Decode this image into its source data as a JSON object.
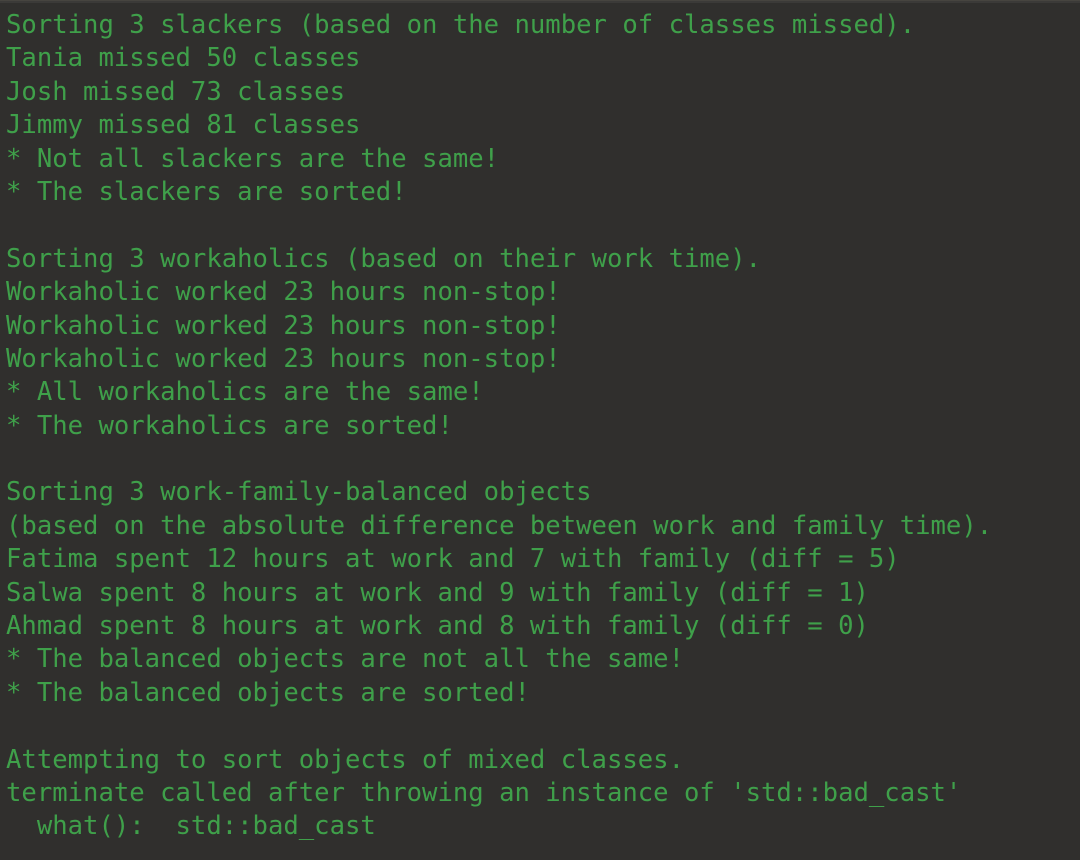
{
  "terminal": {
    "background_color": "#302f2d",
    "text_color": "#3fa04a",
    "border_color": "#3b3a38",
    "lines": [
      {
        "text": "Sorting 3 slackers (based on the number of classes missed).",
        "blank": false
      },
      {
        "text": "Tania missed 50 classes",
        "blank": false
      },
      {
        "text": "Josh missed 73 classes",
        "blank": false
      },
      {
        "text": "Jimmy missed 81 classes",
        "blank": false
      },
      {
        "text": "* Not all slackers are the same!",
        "blank": false
      },
      {
        "text": "* The slackers are sorted!",
        "blank": false
      },
      {
        "text": " ",
        "blank": true
      },
      {
        "text": "Sorting 3 workaholics (based on their work time).",
        "blank": false
      },
      {
        "text": "Workaholic worked 23 hours non-stop!",
        "blank": false
      },
      {
        "text": "Workaholic worked 23 hours non-stop!",
        "blank": false
      },
      {
        "text": "Workaholic worked 23 hours non-stop!",
        "blank": false
      },
      {
        "text": "* All workaholics are the same!",
        "blank": false
      },
      {
        "text": "* The workaholics are sorted!",
        "blank": false
      },
      {
        "text": " ",
        "blank": true
      },
      {
        "text": "Sorting 3 work-family-balanced objects",
        "blank": false
      },
      {
        "text": "(based on the absolute difference between work and family time).",
        "blank": false
      },
      {
        "text": "Fatima spent 12 hours at work and 7 with family (diff = 5)",
        "blank": false
      },
      {
        "text": "Salwa spent 8 hours at work and 9 with family (diff = 1)",
        "blank": false
      },
      {
        "text": "Ahmad spent 8 hours at work and 8 with family (diff = 0)",
        "blank": false
      },
      {
        "text": "* The balanced objects are not all the same!",
        "blank": false
      },
      {
        "text": "* The balanced objects are sorted!",
        "blank": false
      },
      {
        "text": " ",
        "blank": true
      },
      {
        "text": "Attempting to sort objects of mixed classes.",
        "blank": false
      },
      {
        "text": "terminate called after throwing an instance of 'std::bad_cast'",
        "blank": false
      },
      {
        "text": "  what():  std::bad_cast",
        "blank": false
      }
    ]
  }
}
